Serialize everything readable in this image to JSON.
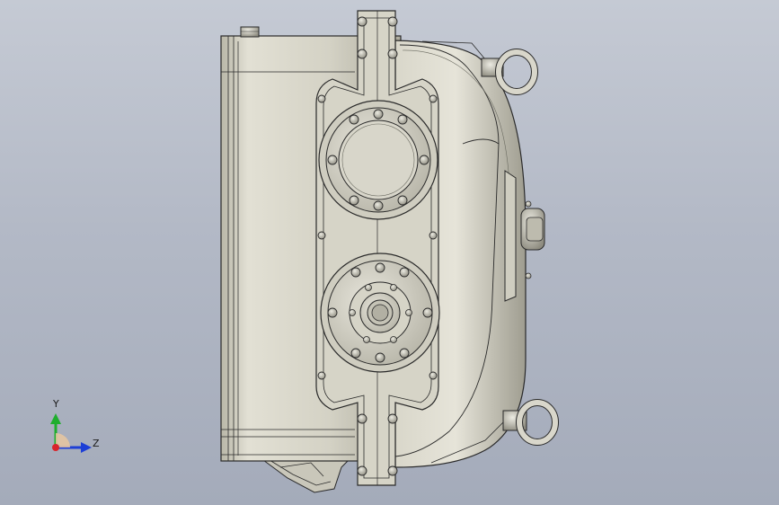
{
  "viewport": {
    "model": "gearbox-side-view",
    "background_top": "#c5cad4",
    "background_bottom": "#a4abba"
  },
  "triad": {
    "y_label": "Y",
    "z_label": "Z",
    "y_color": "#1fae2e",
    "z_color": "#1d3fd6",
    "x_color": "#d8242a"
  }
}
